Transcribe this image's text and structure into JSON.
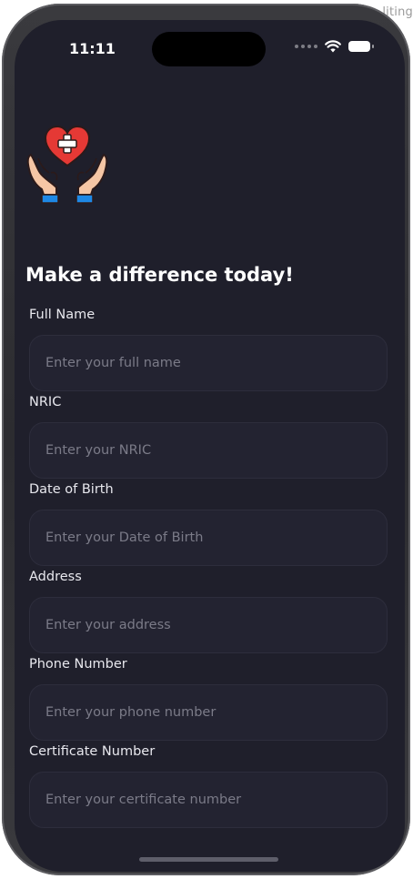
{
  "background": {
    "partial_text": "liting"
  },
  "status_bar": {
    "time": "11:11"
  },
  "page": {
    "headline": "Make a difference today!"
  },
  "form": {
    "fields": [
      {
        "label": "Full Name",
        "placeholder": "Enter your full name",
        "value": ""
      },
      {
        "label": "NRIC",
        "placeholder": "Enter your NRIC",
        "value": ""
      },
      {
        "label": "Date of Birth",
        "placeholder": "Enter your Date of Birth",
        "value": ""
      },
      {
        "label": "Address",
        "placeholder": "Enter your address",
        "value": ""
      },
      {
        "label": "Phone Number",
        "placeholder": "Enter your phone number",
        "value": ""
      },
      {
        "label": "Certificate Number",
        "placeholder": "Enter your certificate number",
        "value": ""
      }
    ]
  },
  "colors": {
    "screen_bg": "#1f1f2b",
    "input_bg": "#232331",
    "heart": "#e53935",
    "accent_blue": "#1e88e5"
  },
  "icons": {
    "logo": "hands-holding-heart-medical-icon",
    "wifi": "wifi-icon",
    "battery": "battery-icon",
    "signal": "cellular-signal-icon"
  }
}
